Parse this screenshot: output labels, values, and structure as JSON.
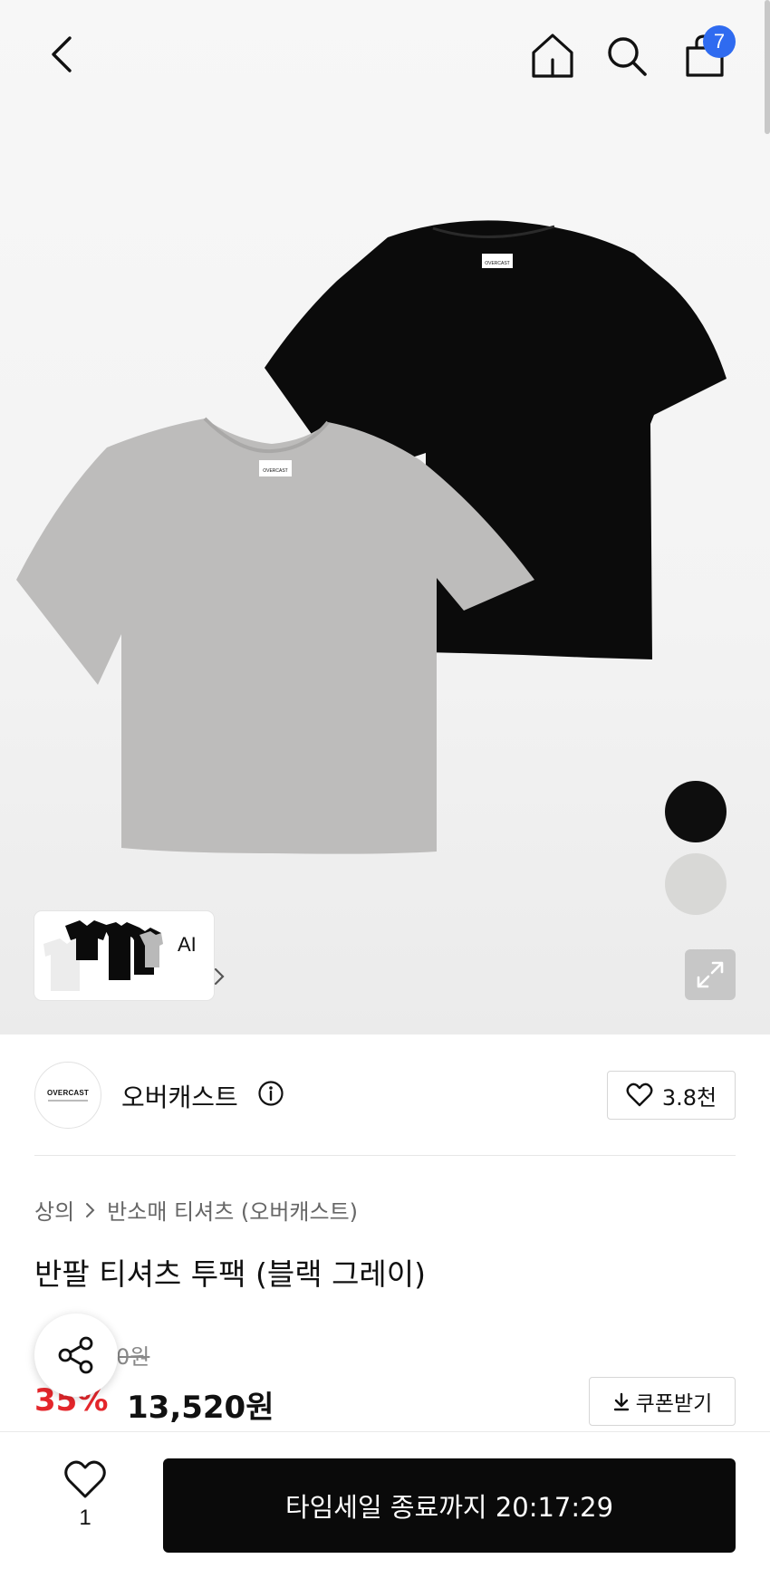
{
  "header": {
    "cart_badge": "7",
    "icons": [
      "chevron-left-icon",
      "home-icon",
      "search-icon",
      "shopping-bag-icon"
    ]
  },
  "gallery": {
    "ai_label": "AI",
    "color_swatches": [
      "#0e0e0e",
      "#d8d8d6"
    ],
    "shirt_tag_text": "OVERCAST"
  },
  "brand": {
    "logo_text": "OVERCAST",
    "name": "오버캐스트",
    "likes": "3.8천"
  },
  "product": {
    "breadcrumb": [
      "상의",
      "반소매 티셔츠 (오버캐스트)"
    ],
    "title": "반팔 티셔츠 투팩 (블랙 그레이)",
    "original_price_visible": "0원",
    "discount": "35%",
    "sale_price": "13,520원",
    "coupon_label": "쿠폰받기"
  },
  "bottom_bar": {
    "wish_count": "1",
    "buy_label": "타임세일 종료까지 20:17:29"
  },
  "colors": {
    "discount_red": "#e4262b",
    "badge_blue": "#2f6bf0",
    "cta_black": "#0a0a0a"
  }
}
